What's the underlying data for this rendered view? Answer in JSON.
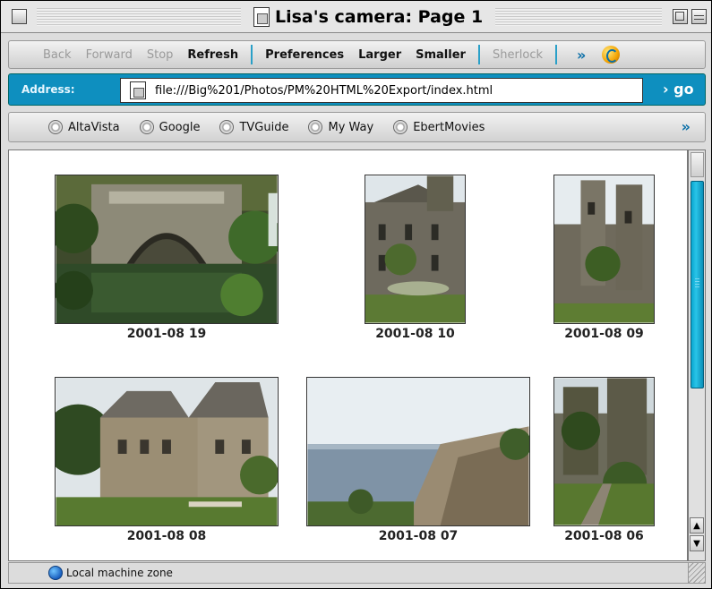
{
  "window": {
    "title": "Lisa's camera: Page 1"
  },
  "toolbar": {
    "back_label": "Back",
    "forward_label": "Forward",
    "stop_label": "Stop",
    "refresh_label": "Refresh",
    "preferences_label": "Preferences",
    "larger_label": "Larger",
    "smaller_label": "Smaller",
    "sherlock_label": "Sherlock",
    "more_label": "»"
  },
  "address": {
    "label": "Address:",
    "value": "file:///Big%201/Photos/PM%20HTML%20Export/index.html",
    "go_label": "› go"
  },
  "favorites": {
    "items": [
      {
        "label": "AltaVista"
      },
      {
        "label": "Google"
      },
      {
        "label": "TVGuide"
      },
      {
        "label": "My Way"
      },
      {
        "label": "EbertMovies"
      }
    ],
    "more_label": "»"
  },
  "gallery": {
    "photos": [
      {
        "caption": "2001-08 19"
      },
      {
        "caption": "2001-08 10"
      },
      {
        "caption": "2001-08 09"
      },
      {
        "caption": "2001-08 08"
      },
      {
        "caption": "2001-08 07"
      },
      {
        "caption": "2001-08 06"
      }
    ]
  },
  "status": {
    "zone_text": "Local machine zone"
  }
}
